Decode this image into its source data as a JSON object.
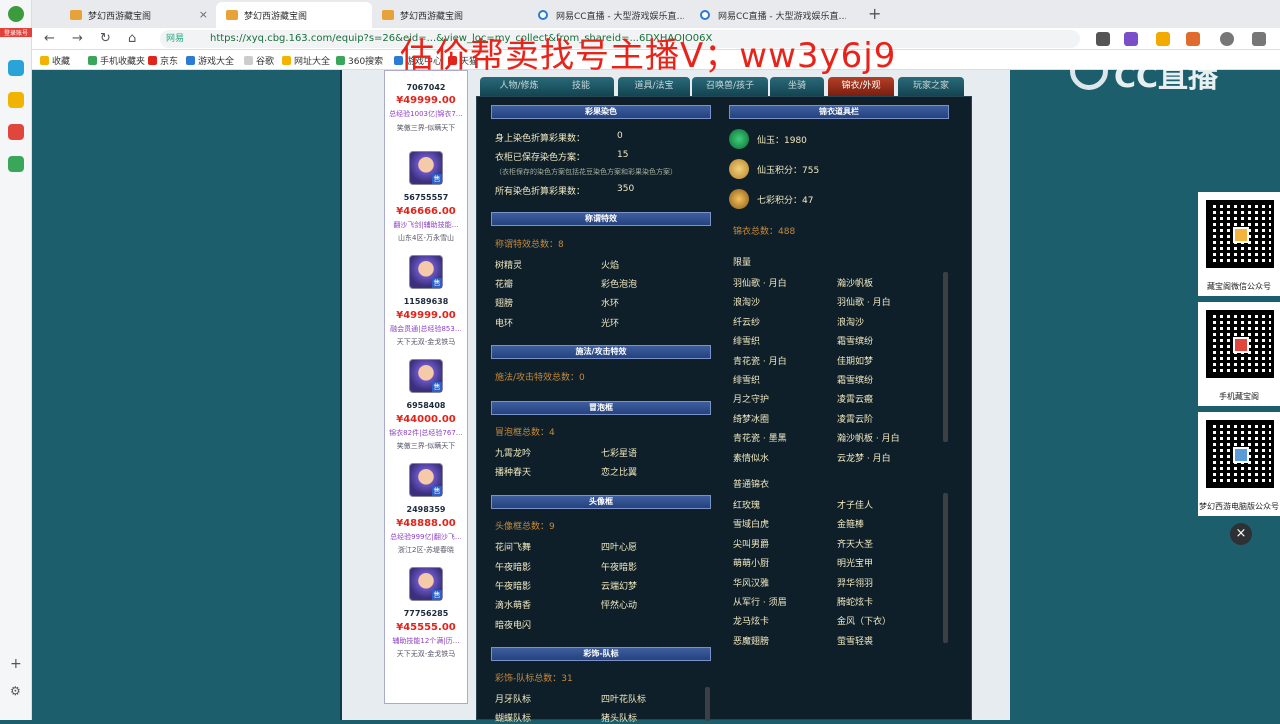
{
  "browser": {
    "tabs": [
      {
        "title": "梦幻西游藏宝阁",
        "active": true
      },
      {
        "title": "梦幻西游藏宝阁",
        "active": false
      },
      {
        "title": "梦幻西游藏宝阁",
        "active": false
      },
      {
        "title": "网易CC直播 - 大型游戏娱乐直…",
        "active": false
      },
      {
        "title": "网易CC直播 - 大型游戏娱乐直…",
        "active": false
      }
    ],
    "new_tab": "+",
    "site_badge": "网易",
    "url": "https://xyq.cbg.163.com/equip?s=26&eid=...&view_loc=my_collect&from_shareid=...6DXHAOJO06X",
    "bookmarks": [
      "收藏",
      "手机收藏夹",
      "京东",
      "游戏大全",
      "谷歌",
      "网址大全",
      "360搜索",
      "游戏中心",
      "天猫"
    ]
  },
  "watermark": "估价帮卖找号主播V；ww3y6j9",
  "cc_logo": "CC直播",
  "sidebar_label": "登录账号",
  "listing": [
    {
      "id": "7067042",
      "price": "¥49999.00",
      "tags": "总经验1003亿|锦衣7…",
      "server": "笑傲三界-似瞒天下"
    },
    {
      "id": "56755557",
      "price": "¥46666.00",
      "tags": "翻沙飞剑|辅助技能…",
      "server": "山东4区-万永雪山"
    },
    {
      "id": "11589638",
      "price": "¥49999.00",
      "tags": "融会贯通|总经验853…",
      "server": "天下无双-金戈铁马"
    },
    {
      "id": "6958408",
      "price": "¥44000.00",
      "tags": "锦衣82件|总经验767…",
      "server": "笑傲三界-似瞒天下"
    },
    {
      "id": "2498359",
      "price": "¥48888.00",
      "tags": "总经验999亿|翻沙飞…",
      "server": "浙江2区-苏堤春晓"
    },
    {
      "id": "77756285",
      "price": "¥45555.00",
      "tags": "辅助技能12个满|历…",
      "server": "天下无双-金戈铁马"
    }
  ],
  "page_tabs": [
    {
      "label": "人物/修炼",
      "active": false
    },
    {
      "label": "技能",
      "active": false
    },
    {
      "label": "道具/法宝",
      "active": false
    },
    {
      "label": "召唤兽/孩子",
      "active": false
    },
    {
      "label": "坐骑",
      "active": false
    },
    {
      "label": "锦衣/外观",
      "active": true
    },
    {
      "label": "玩家之家",
      "active": false
    }
  ],
  "left": {
    "dye": {
      "title": "彩果染色",
      "rows": [
        {
          "label": "身上染色折算彩果数：",
          "value": "0"
        },
        {
          "label": "衣柜已保存染色方案：",
          "value": "15"
        },
        {
          "label": "所有染色折算彩果数：",
          "value": "350"
        }
      ],
      "note": "（衣柜保存的染色方案包括花豆染色方案和彩果染色方案）"
    },
    "title_effects": {
      "title": "称谓特效",
      "total": "称谓特效总数：8",
      "items": [
        "树精灵",
        "火焰",
        "花瓣",
        "彩色泡泡",
        "翅膀",
        "水环",
        "电环",
        "光环"
      ]
    },
    "spell_effects": {
      "title": "施法/攻击特效",
      "total": "施法/攻击特效总数：0"
    },
    "bubbles": {
      "title": "冒泡框",
      "total": "冒泡框总数：4",
      "items": [
        "九霄龙吟",
        "七彩星语",
        "播种春天",
        "恋之比翼"
      ]
    },
    "avatar_frames": {
      "title": "头像框",
      "total": "头像框总数：9",
      "items": [
        "花间飞舞",
        "四叶心愿",
        "午夜暗影",
        "午夜暗影",
        "午夜暗影",
        "云端幻梦",
        "滴水萌香",
        "怦然心动",
        "暗夜电闪"
      ]
    },
    "team_marks": {
      "title": "彩饰-队标",
      "total": "彩饰-队标总数：31",
      "items": [
        "月牙队标",
        "四叶花队标",
        "蝴蝶队标",
        "猪头队标"
      ]
    }
  },
  "right": {
    "title": "锦衣道具栏",
    "currencies": [
      {
        "name": "仙玉：1980"
      },
      {
        "name": "仙玉积分：755"
      },
      {
        "name": "七彩积分：47"
      }
    ],
    "total": "锦衣总数：488",
    "limited": {
      "title": "限量",
      "items": [
        "羽仙歌 · 月白",
        "瀚沙帆板",
        "浪淘沙",
        "羽仙歌 · 月白",
        "纤云纱",
        "浪淘沙",
        "绯雪织",
        "霜雪缤纷",
        "青花瓷 · 月白",
        "佳期如梦",
        "绯雪织",
        "霜雪缤纷",
        "月之守护",
        "凌霄云瘢",
        "绮梦冰圈",
        "凌霄云阶",
        "青花瓷 · 墨黑",
        "瀚沙帆板 · 月白",
        "素情似水",
        "云龙梦 · 月白"
      ]
    },
    "normal": {
      "title": "普通锦衣",
      "items": [
        "红玫瑰",
        "才子佳人",
        "雪域白虎",
        "金箍棒",
        "尖叫男爵",
        "齐天大圣",
        "萌萌小厨",
        "明光宝甲",
        "华风汉雅",
        "羿华翎羽",
        "从军行 · 须眉",
        "腾蛇炫卡",
        "龙马炫卡",
        "金风（下衣）",
        "恶魔翅膀",
        "萤雪轻裘"
      ]
    }
  },
  "qr_cards": [
    {
      "caption": "藏宝阁微信公众号"
    },
    {
      "caption": "手机藏宝阁"
    },
    {
      "caption": "梦幻西游电脑版公众号"
    }
  ],
  "close_label": "×"
}
